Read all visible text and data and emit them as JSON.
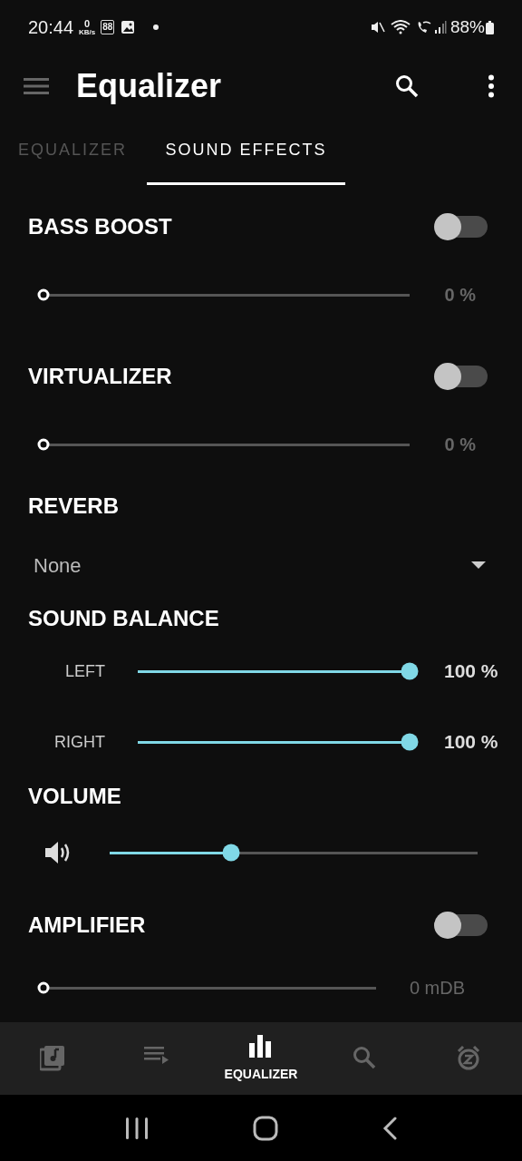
{
  "status_bar": {
    "time": "20:44",
    "net_speed": "0",
    "net_unit": "KB/s",
    "badge": "88",
    "battery": "88%"
  },
  "app_bar": {
    "title": "Equalizer"
  },
  "tabs": [
    {
      "label": "EQUALIZER",
      "selected": false
    },
    {
      "label": "SOUND EFFECTS",
      "selected": true
    }
  ],
  "sections": [
    {
      "kind": "toggle_slider",
      "title": "BASS BOOST",
      "on": false,
      "level": 0,
      "reading": "0 %"
    },
    {
      "kind": "toggle_slider",
      "title": "VIRTUALIZER",
      "on": false,
      "level": 0,
      "reading": "0 %"
    },
    {
      "kind": "dropdown",
      "title": "REVERB",
      "value": "None"
    },
    {
      "kind": "balance",
      "title": "SOUND BALANCE",
      "channels": [
        {
          "label": "LEFT",
          "level": 1,
          "reading": "100 %"
        },
        {
          "label": "RIGHT",
          "level": 1,
          "reading": "100 %"
        }
      ]
    },
    {
      "kind": "volume",
      "title": "VOLUME",
      "level": 0.33
    },
    {
      "kind": "amplifier",
      "title": "AMPLIFIER",
      "on": false,
      "level": 0,
      "reading": "0 mDB"
    }
  ],
  "bottom_nav": [
    {
      "selected": false
    },
    {
      "selected": false
    },
    {
      "label": "EQUALIZER",
      "selected": true
    },
    {
      "selected": false
    },
    {
      "selected": false
    }
  ]
}
